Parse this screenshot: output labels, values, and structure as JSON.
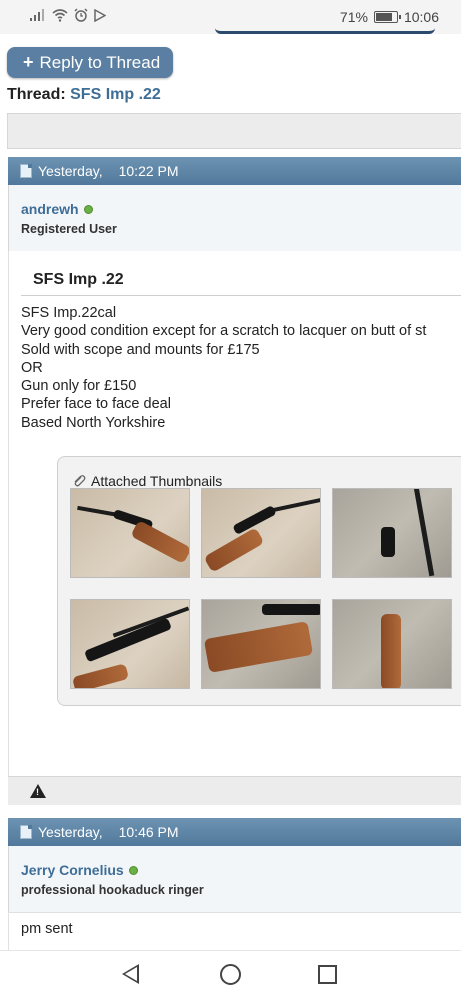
{
  "status_bar": {
    "battery": "71%",
    "time": "10:06",
    "icons": [
      "signal-icon",
      "wifi-icon",
      "alarm-icon",
      "nfc-icon"
    ]
  },
  "actions": {
    "reply_label": "Reply to Thread"
  },
  "thread": {
    "prefix": "Thread:",
    "title": "SFS Imp .22"
  },
  "posts": [
    {
      "date": "Yesterday,",
      "time": "10:22 PM",
      "username": "andrewh",
      "user_title": "Registered User",
      "title": "SFS Imp .22",
      "lines": [
        "SFS Imp.22cal",
        "Very good condition except for a scratch to lacquer on butt of st",
        "Sold with scope and mounts for £175",
        "OR",
        "Gun only for £150",
        "Prefer face to face deal",
        "Based North Yorkshire"
      ],
      "attachments_label": "Attached Thumbnails"
    },
    {
      "date": "Yesterday,",
      "time": "10:46 PM",
      "username": "Jerry Cornelius",
      "user_title": "professional hookaduck ringer",
      "body": "pm sent"
    }
  ],
  "colors": {
    "accent": "#5a7fa2",
    "link": "#3e6d96",
    "online": "#69b045"
  }
}
